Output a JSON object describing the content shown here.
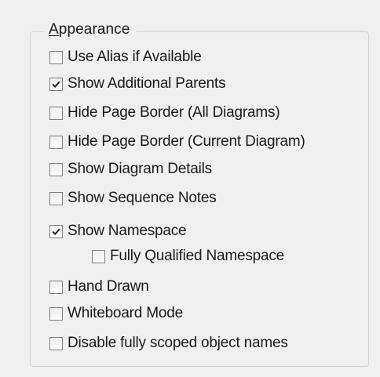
{
  "group": {
    "title_mnemonic": "A",
    "title_rest": "ppearance"
  },
  "options": [
    {
      "label": "Use Alias if Available",
      "checked": false,
      "indent": false
    },
    {
      "label": "Show Additional Parents",
      "checked": true,
      "indent": false
    },
    {
      "label": "Hide Page Border (All Diagrams)",
      "checked": false,
      "indent": false
    },
    {
      "label": "Hide Page Border (Current Diagram)",
      "checked": false,
      "indent": false
    },
    {
      "label": "Show Diagram Details",
      "checked": false,
      "indent": false
    },
    {
      "label": "Show Sequence Notes",
      "checked": false,
      "indent": false
    },
    {
      "label": "Show Namespace",
      "checked": true,
      "indent": false
    },
    {
      "label": "Fully Qualified Namespace",
      "checked": false,
      "indent": true
    },
    {
      "label": "Hand Drawn",
      "checked": false,
      "indent": false
    },
    {
      "label": "Whiteboard Mode",
      "checked": false,
      "indent": false
    },
    {
      "label": "Disable fully scoped object names",
      "checked": false,
      "indent": false
    }
  ]
}
